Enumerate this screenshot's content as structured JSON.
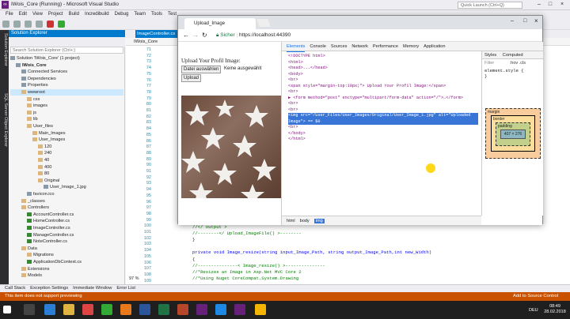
{
  "vs": {
    "title": "IWois_Core (Running) - Microsoft Visual Studio",
    "quick_launch": "Quick Launch (Ctrl+Q)",
    "menu": [
      "File",
      "Edit",
      "View",
      "Project",
      "Build",
      "Incredibuild",
      "Debug",
      "Team",
      "Tools",
      "Test"
    ],
    "side_tabs": [
      "Solution Explorer",
      "SQL Server Object Explorer"
    ]
  },
  "solution_explorer": {
    "title": "Solution Explorer",
    "search": "Search Solution Explorer (Ctrl+;)",
    "items": [
      {
        "label": "Solution 'IWois_Core' (1 project)",
        "indent": 0,
        "kind": "file"
      },
      {
        "label": "IWois_Core",
        "indent": 1,
        "kind": "file",
        "bold": true
      },
      {
        "label": "Connected Services",
        "indent": 2,
        "kind": "file"
      },
      {
        "label": "Dependencies",
        "indent": 2,
        "kind": "file"
      },
      {
        "label": "Properties",
        "indent": 2,
        "kind": "file"
      },
      {
        "label": "wwwroot",
        "indent": 2,
        "kind": "folder",
        "selected": true
      },
      {
        "label": "css",
        "indent": 3,
        "kind": "folder"
      },
      {
        "label": "images",
        "indent": 3,
        "kind": "folder"
      },
      {
        "label": "js",
        "indent": 3,
        "kind": "folder"
      },
      {
        "label": "lib",
        "indent": 3,
        "kind": "folder"
      },
      {
        "label": "User_files",
        "indent": 3,
        "kind": "folder"
      },
      {
        "label": "Main_Images",
        "indent": 4,
        "kind": "folder"
      },
      {
        "label": "User_Images",
        "indent": 4,
        "kind": "folder"
      },
      {
        "label": "120",
        "indent": 5,
        "kind": "folder"
      },
      {
        "label": "240",
        "indent": 5,
        "kind": "folder"
      },
      {
        "label": "40",
        "indent": 5,
        "kind": "folder"
      },
      {
        "label": "400",
        "indent": 5,
        "kind": "folder"
      },
      {
        "label": "80",
        "indent": 5,
        "kind": "folder"
      },
      {
        "label": "Original",
        "indent": 5,
        "kind": "folder"
      },
      {
        "label": "User_Image_1.jpg",
        "indent": 6,
        "kind": "file"
      },
      {
        "label": "favicon.ico",
        "indent": 3,
        "kind": "file"
      },
      {
        "label": "_classes",
        "indent": 2,
        "kind": "folder"
      },
      {
        "label": "Controllers",
        "indent": 2,
        "kind": "folder"
      },
      {
        "label": "AccountController.cs",
        "indent": 3,
        "kind": "cs"
      },
      {
        "label": "HomeController.cs",
        "indent": 3,
        "kind": "cs"
      },
      {
        "label": "ImageController.cs",
        "indent": 3,
        "kind": "cs"
      },
      {
        "label": "ManageController.cs",
        "indent": 3,
        "kind": "cs"
      },
      {
        "label": "NoteController.cs",
        "indent": 3,
        "kind": "cs"
      },
      {
        "label": "Data",
        "indent": 2,
        "kind": "folder"
      },
      {
        "label": "Migrations",
        "indent": 3,
        "kind": "folder"
      },
      {
        "label": "ApplicationDbContext.cs",
        "indent": 3,
        "kind": "cs"
      },
      {
        "label": "Extensions",
        "indent": 2,
        "kind": "folder"
      },
      {
        "label": "Models",
        "indent": 2,
        "kind": "folder"
      }
    ]
  },
  "editor": {
    "tab": "ImageController.cs",
    "nav": "IWois_Core",
    "zoom": "97 %",
    "line_numbers": [
      "71",
      "72",
      "73",
      "74",
      "75",
      "76",
      "77",
      "78",
      "79",
      "80",
      "81",
      "82",
      "83",
      "84",
      "85",
      "86",
      "87",
      "88",
      "89",
      "90",
      "91",
      "92",
      "93",
      "94",
      "95",
      "96",
      "97",
      "98",
      "99",
      "100",
      "101",
      "102",
      "103",
      "104",
      "105",
      "106",
      "107",
      "108",
      "109"
    ],
    "code": [
      {
        "text": "//</ output >",
        "cls": "cm"
      },
      {
        "text": "//--------</ Upload_ImageFile() >--------",
        "cls": "cm"
      },
      {
        "text": "}",
        "cls": ""
      },
      {
        "text": "",
        "cls": ""
      },
      {
        "text": "private void Image_resize(string input_Image_Path, string output_Image_Path,int new_Width)",
        "cls": "kw"
      },
      {
        "text": "{",
        "cls": ""
      },
      {
        "text": "   //---------------< Image_resize() >---------------",
        "cls": "cm"
      },
      {
        "text": "   //*Resizes an Image in Asp.Net MVC Core 2",
        "cls": "cm"
      },
      {
        "text": "   //*Using Nuget CoreCompat.System.Drawing",
        "cls": "cm"
      }
    ]
  },
  "output_tabs": [
    "Call Stack",
    "Exception Settings",
    "Immediate Window",
    "Error List"
  ],
  "status": {
    "left": "This item does not support previewing",
    "right": "Add to Source Control"
  },
  "clock": {
    "time": "08:49",
    "date": "28.02.2018",
    "lang": "DEU"
  },
  "chrome": {
    "tab": "Upload_Image",
    "secure": "Sicher",
    "url": "https://localhost:44390",
    "page": {
      "heading": "Upload Your Profil Image:",
      "choose_btn": "Datei auswählen",
      "no_file": "Keine ausgewählt",
      "upload_btn": "Upload"
    },
    "devtools": {
      "tabs": [
        "Elements",
        "Console",
        "Sources",
        "Network",
        "Performance",
        "Memory",
        "Application"
      ],
      "dom": [
        "<!DOCTYPE html>",
        "<html>",
        "  <head>...</head>",
        "  <body>",
        "    <br>",
        "    <span style=\"margin-top:10px;\"> Upload Your Profil Image:</span>",
        "    <br>",
        "  ▶ <form method=\"post\" enctype=\"multipart/form-data\" action=\"/\">…</form>",
        "    <br>",
        "    <br>",
        "    <img src=\"/User_Files/User_Images/Original/User_Image_1.jpg\" alt=\"Uploaded",
        "    Image\"> == $0",
        "    <br>",
        "  </body>",
        "</html>"
      ],
      "selected_line": 10,
      "styles_tabs": [
        "Styles",
        "Computed"
      ],
      "filter": "Filter",
      "hov": ":hov .cls",
      "element_style": "element.style {",
      "element_style_close": "}",
      "box": {
        "margin": "margin",
        "border": "border",
        "padding": "padding",
        "size": "407 × 276",
        "dash": "-"
      },
      "crumbs": [
        "html",
        "body",
        "img"
      ]
    }
  }
}
